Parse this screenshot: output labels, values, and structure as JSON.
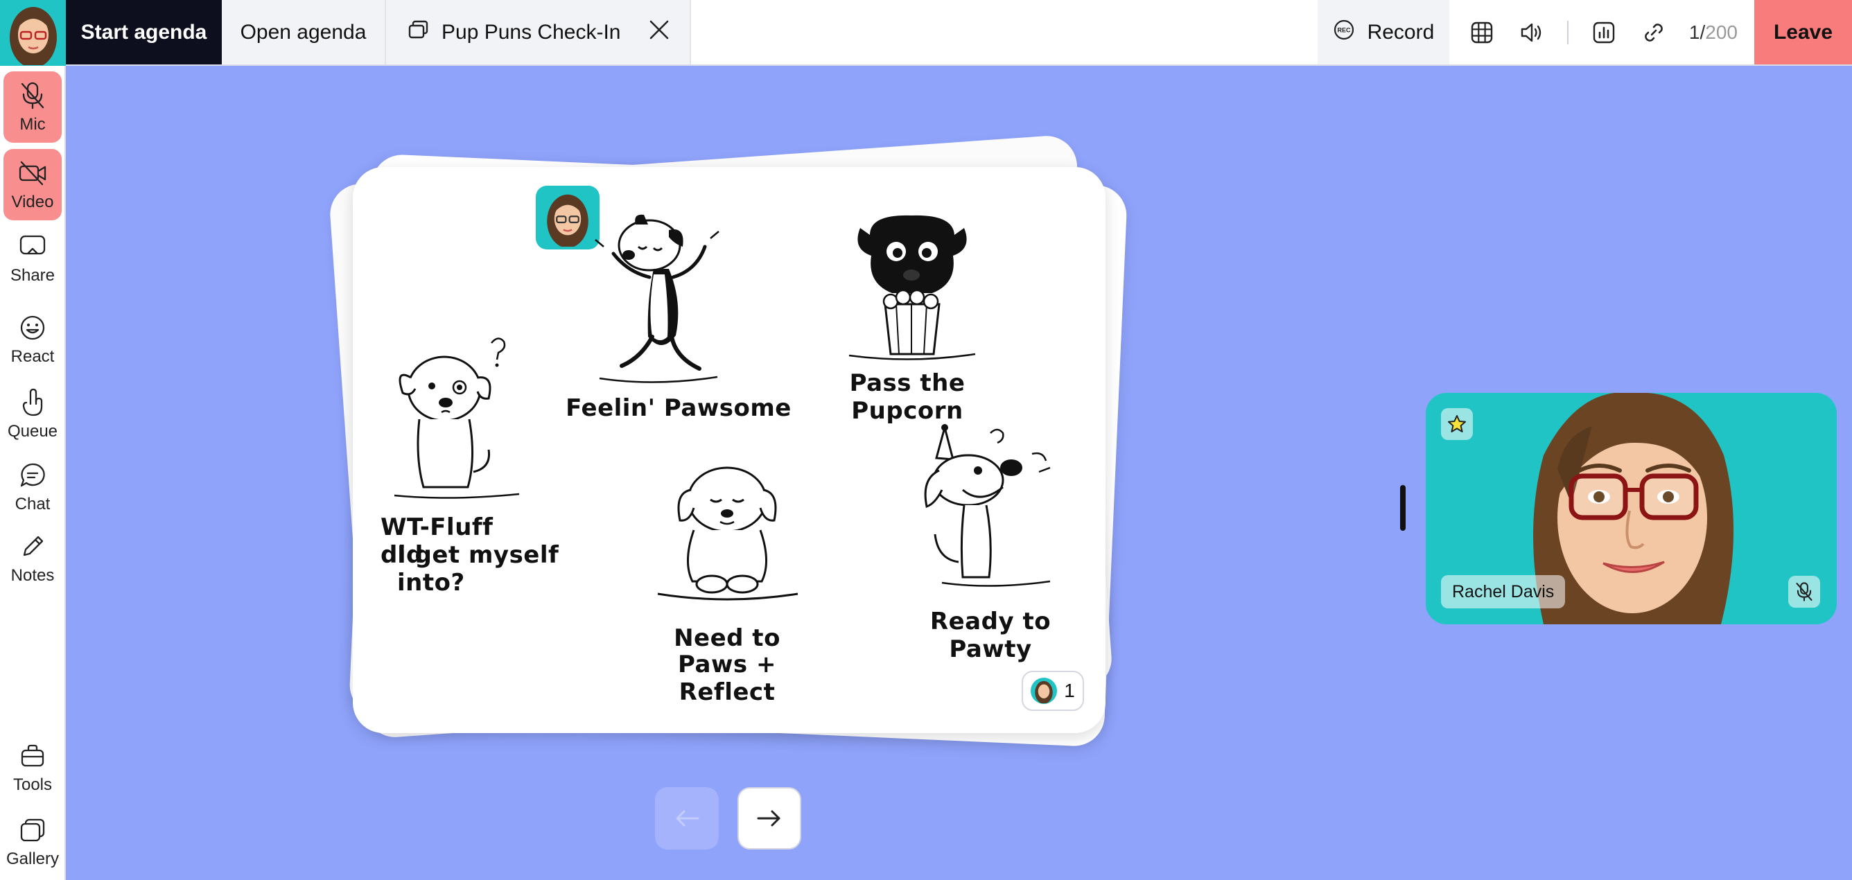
{
  "topbar": {
    "start_agenda": "Start agenda",
    "open_agenda": "Open agenda",
    "tab_title": "Pup Puns Check-In",
    "record_badge": "REC",
    "record_label": "Record",
    "participant_count": "1/",
    "participant_limit": "200",
    "leave_label": "Leave"
  },
  "sidebar": {
    "mic": "Mic",
    "video": "Video",
    "share": "Share",
    "react": "React",
    "queue": "Queue",
    "chat": "Chat",
    "notes": "Notes",
    "tools": "Tools",
    "gallery": "Gallery"
  },
  "card": {
    "captions": {
      "feelin": "Feelin' Pawsome",
      "pupcorn": "Pass the Pupcorn",
      "wtfluff_line1": "WT-Fluff did",
      "wtfluff_line2": "I get myself into?",
      "reflect_line1": "Need to",
      "reflect_line2": "Paws + Reflect",
      "pawty": "Ready to Pawty"
    },
    "vote_count": "1"
  },
  "participant": {
    "name": "Rachel Davis"
  },
  "colors": {
    "background": "#8fa3fb",
    "teal": "#20c4c4",
    "leave": "#f97c7c",
    "muted_button": "#f88e8e",
    "dark_button": "#0d0f1f"
  }
}
